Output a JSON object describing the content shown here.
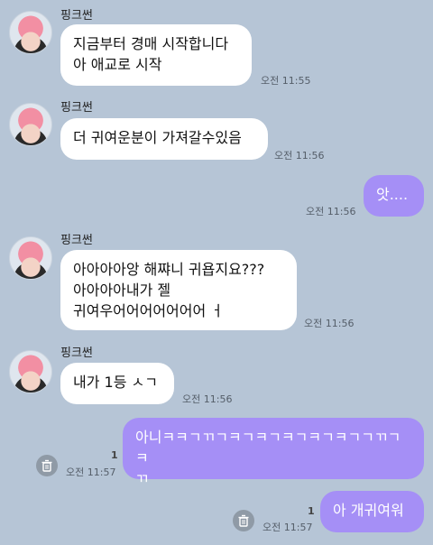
{
  "chat": {
    "sender_name": "핑크썬",
    "messages": [
      {
        "text": "지금부터 경매 시작합니다\n아 애교로 시작",
        "time": "오전 11:55"
      },
      {
        "text": "더 귀여운분이 가져갈수있음",
        "time": "오전 11:56"
      },
      {
        "text": "앗....",
        "time": "오전 11:56"
      },
      {
        "text": "아아아아앙 해쨔니 귀욥지요???\n아아아아내가 젤\n귀여우어어어어어어어 ㅓ",
        "time": "오전 11:56"
      },
      {
        "text": "내가 1등 ㅅㄱ",
        "time": "오전 11:56"
      },
      {
        "text": "아니ㅋㅋㄱㄲㄱㅋㄱㅋㄱㅋㄱㅋㄱㅋㄱㄱㄲㄱㅋ\nㄲ",
        "time": "오전 11:57",
        "unread": "1"
      },
      {
        "text": "아 개귀여워",
        "time": "오전 11:57",
        "unread": "1"
      }
    ]
  },
  "colors": {
    "background": "#b6c5d6",
    "incoming": "#ffffff",
    "outgoing": "#a58ff6"
  },
  "icons": {
    "avatar": "profile-avatar",
    "delete": "trash-icon"
  }
}
